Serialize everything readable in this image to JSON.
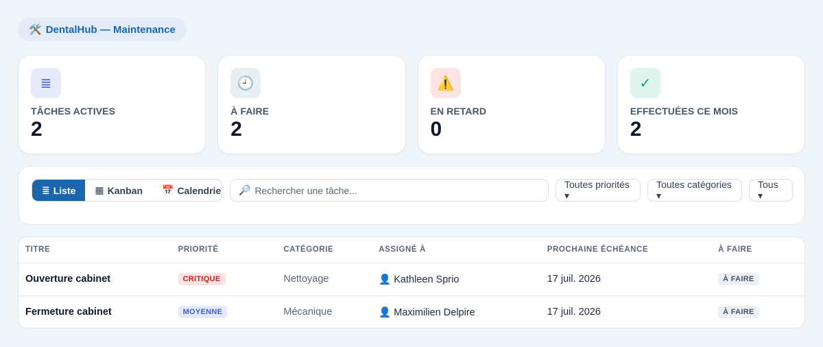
{
  "app": {
    "icon": "tools-icon",
    "title": "DentalHub — Maintenance",
    "icon_glyph": "🛠️"
  },
  "stats": [
    {
      "icon": "list-icon",
      "glyph": "≣",
      "label": "TÂCHES ACTIVES",
      "value": "2"
    },
    {
      "icon": "clock-icon",
      "glyph": "🕘",
      "label": "À FAIRE",
      "value": "2"
    },
    {
      "icon": "warning-icon",
      "glyph": "⚠️",
      "label": "EN RETARD",
      "value": "0"
    },
    {
      "icon": "check-icon",
      "glyph": "✓",
      "label": "EFFECTUÉES CE MOIS",
      "value": "2"
    }
  ],
  "toolbar": {
    "views": [
      {
        "glyph": "≣",
        "label": "Liste",
        "active": true
      },
      {
        "glyph": "▦",
        "label": "Kanban",
        "active": false
      },
      {
        "glyph": "📅",
        "label": "Calendrier",
        "active": false
      }
    ],
    "search": {
      "glyph": "🔎",
      "placeholder": "Rechercher une tâche..."
    },
    "filters": {
      "priority": "Toutes priorités ▾",
      "category": "Toutes catégories ▾",
      "status": "Tous ▾"
    }
  },
  "table": {
    "headers": [
      "TITRE",
      "PRIORITÉ",
      "CATÉGORIE",
      "ASSIGNÉ À",
      "PROCHAINE ÉCHÉANCE",
      "À FAIRE"
    ],
    "rows": [
      {
        "title": "Ouverture cabinet",
        "priority": "CRITIQUE",
        "category": "Nettoyage",
        "assignee": "Kathleen Sprio",
        "due": "17 juil. 2026",
        "status": "À FAIRE"
      },
      {
        "title": "Fermeture cabinet",
        "priority": "MOYENNE",
        "category": "Mécanique",
        "assignee": "Maximilien Delpire",
        "due": "17 juil. 2026",
        "status": "À FAIRE"
      }
    ],
    "user_glyph": "👤"
  },
  "colors": {
    "accent": "#1a66ad",
    "critical": "#c81e1e",
    "medium": "#3f5fd0",
    "background": "#f0f5fa"
  }
}
